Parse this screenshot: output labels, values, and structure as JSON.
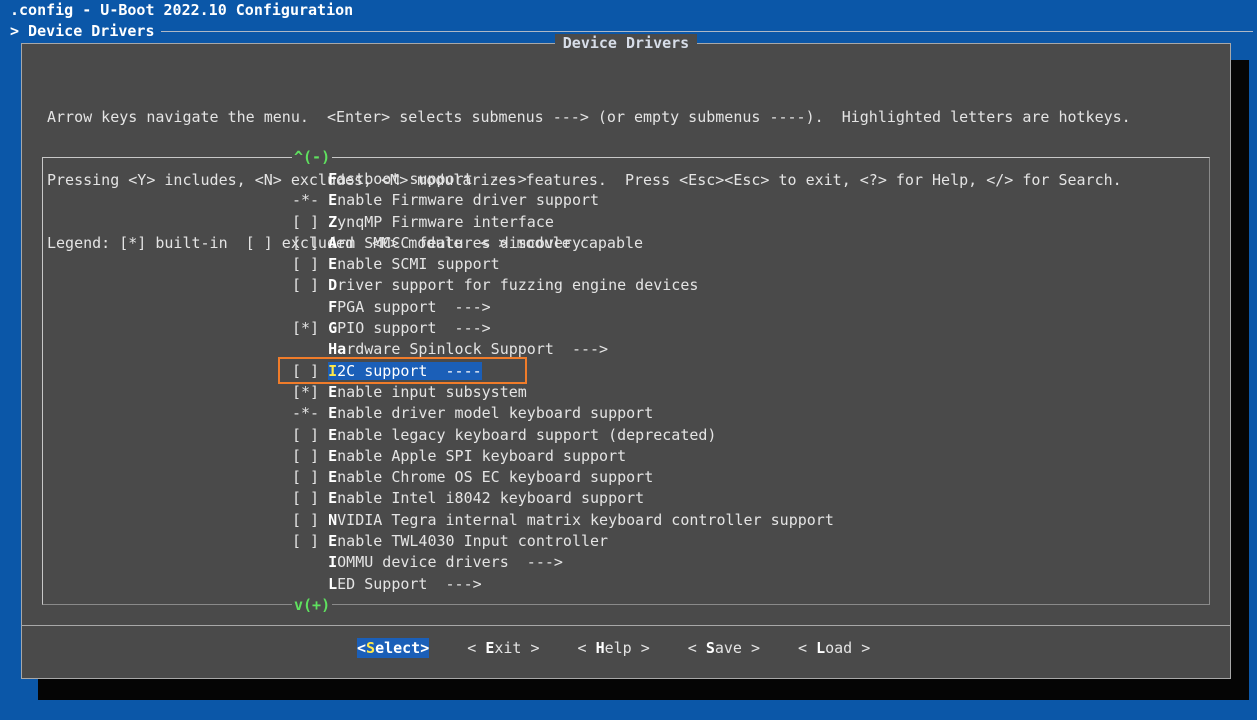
{
  "window": {
    "title": ".config - U-Boot 2022.10 Configuration",
    "breadcrumb": "> Device Drivers"
  },
  "dialog": {
    "title": "Device Drivers",
    "help_lines": [
      "Arrow keys navigate the menu.  <Enter> selects submenus ---> (or empty submenus ----).  Highlighted letters are hotkeys.",
      "Pressing <Y> includes, <N> excludes, <M> modularizes features.  Press <Esc><Esc> to exit, <?> for Help, </> for Search.",
      "Legend: [*] built-in  [ ] excluded  <M> module  < > module capable"
    ]
  },
  "menu": {
    "scroll_up": "^(-)",
    "scroll_down": "v(+)",
    "items": [
      {
        "prefix": "    ",
        "hotkey": "F",
        "rest": "astboot support  --->"
      },
      {
        "prefix": "-*- ",
        "hotkey": "E",
        "rest": "nable Firmware driver support"
      },
      {
        "prefix": "[ ] ",
        "hotkey": "Z",
        "rest": "ynqMP Firmware interface"
      },
      {
        "prefix": "[ ] ",
        "hotkey": "A",
        "rest": "rm SMCCC features discovery"
      },
      {
        "prefix": "[ ] ",
        "hotkey": "E",
        "rest": "nable SCMI support"
      },
      {
        "prefix": "[ ] ",
        "hotkey": "D",
        "rest": "river support for fuzzing engine devices"
      },
      {
        "prefix": "    ",
        "hotkey": "F",
        "rest": "PGA support  --->"
      },
      {
        "prefix": "[*] ",
        "hotkey": "G",
        "rest": "PIO support  --->"
      },
      {
        "prefix": "    ",
        "hotkey": "Ha",
        "rest": "rdware Spinlock Support  --->"
      },
      {
        "prefix": "[ ] ",
        "hotkey": "I",
        "rest": "2C support  ----"
      },
      {
        "prefix": "[*] ",
        "hotkey": "E",
        "rest": "nable input subsystem"
      },
      {
        "prefix": "-*- ",
        "hotkey": "E",
        "rest": "nable driver model keyboard support"
      },
      {
        "prefix": "[ ] ",
        "hotkey": "E",
        "rest": "nable legacy keyboard support (deprecated)"
      },
      {
        "prefix": "[ ] ",
        "hotkey": "E",
        "rest": "nable Apple SPI keyboard support"
      },
      {
        "prefix": "[ ] ",
        "hotkey": "E",
        "rest": "nable Chrome OS EC keyboard support"
      },
      {
        "prefix": "[ ] ",
        "hotkey": "E",
        "rest": "nable Intel i8042 keyboard support"
      },
      {
        "prefix": "[ ] ",
        "hotkey": "N",
        "rest": "VIDIA Tegra internal matrix keyboard controller support"
      },
      {
        "prefix": "[ ] ",
        "hotkey": "E",
        "rest": "nable TWL4030 Input controller"
      },
      {
        "prefix": "    ",
        "hotkey": "I",
        "rest": "OMMU device drivers  --->"
      },
      {
        "prefix": "    ",
        "hotkey": "L",
        "rest": "ED Support  --->"
      }
    ],
    "selected_index": 9
  },
  "buttons": [
    {
      "pre": "<",
      "hotkey": "S",
      "post": "elect>"
    },
    {
      "pre": "< ",
      "hotkey": "E",
      "post": "xit >"
    },
    {
      "pre": "< ",
      "hotkey": "H",
      "post": "elp >"
    },
    {
      "pre": "< ",
      "hotkey": "S",
      "post": "ave >"
    },
    {
      "pre": "< ",
      "hotkey": "L",
      "post": "oad >"
    }
  ],
  "colors": {
    "background": "#0b57a8",
    "dialog": "#4a4a4a",
    "selection": "#1b5fb8",
    "scroll_indicator": "#5fe05f",
    "annotation_box": "#f07c2a"
  }
}
